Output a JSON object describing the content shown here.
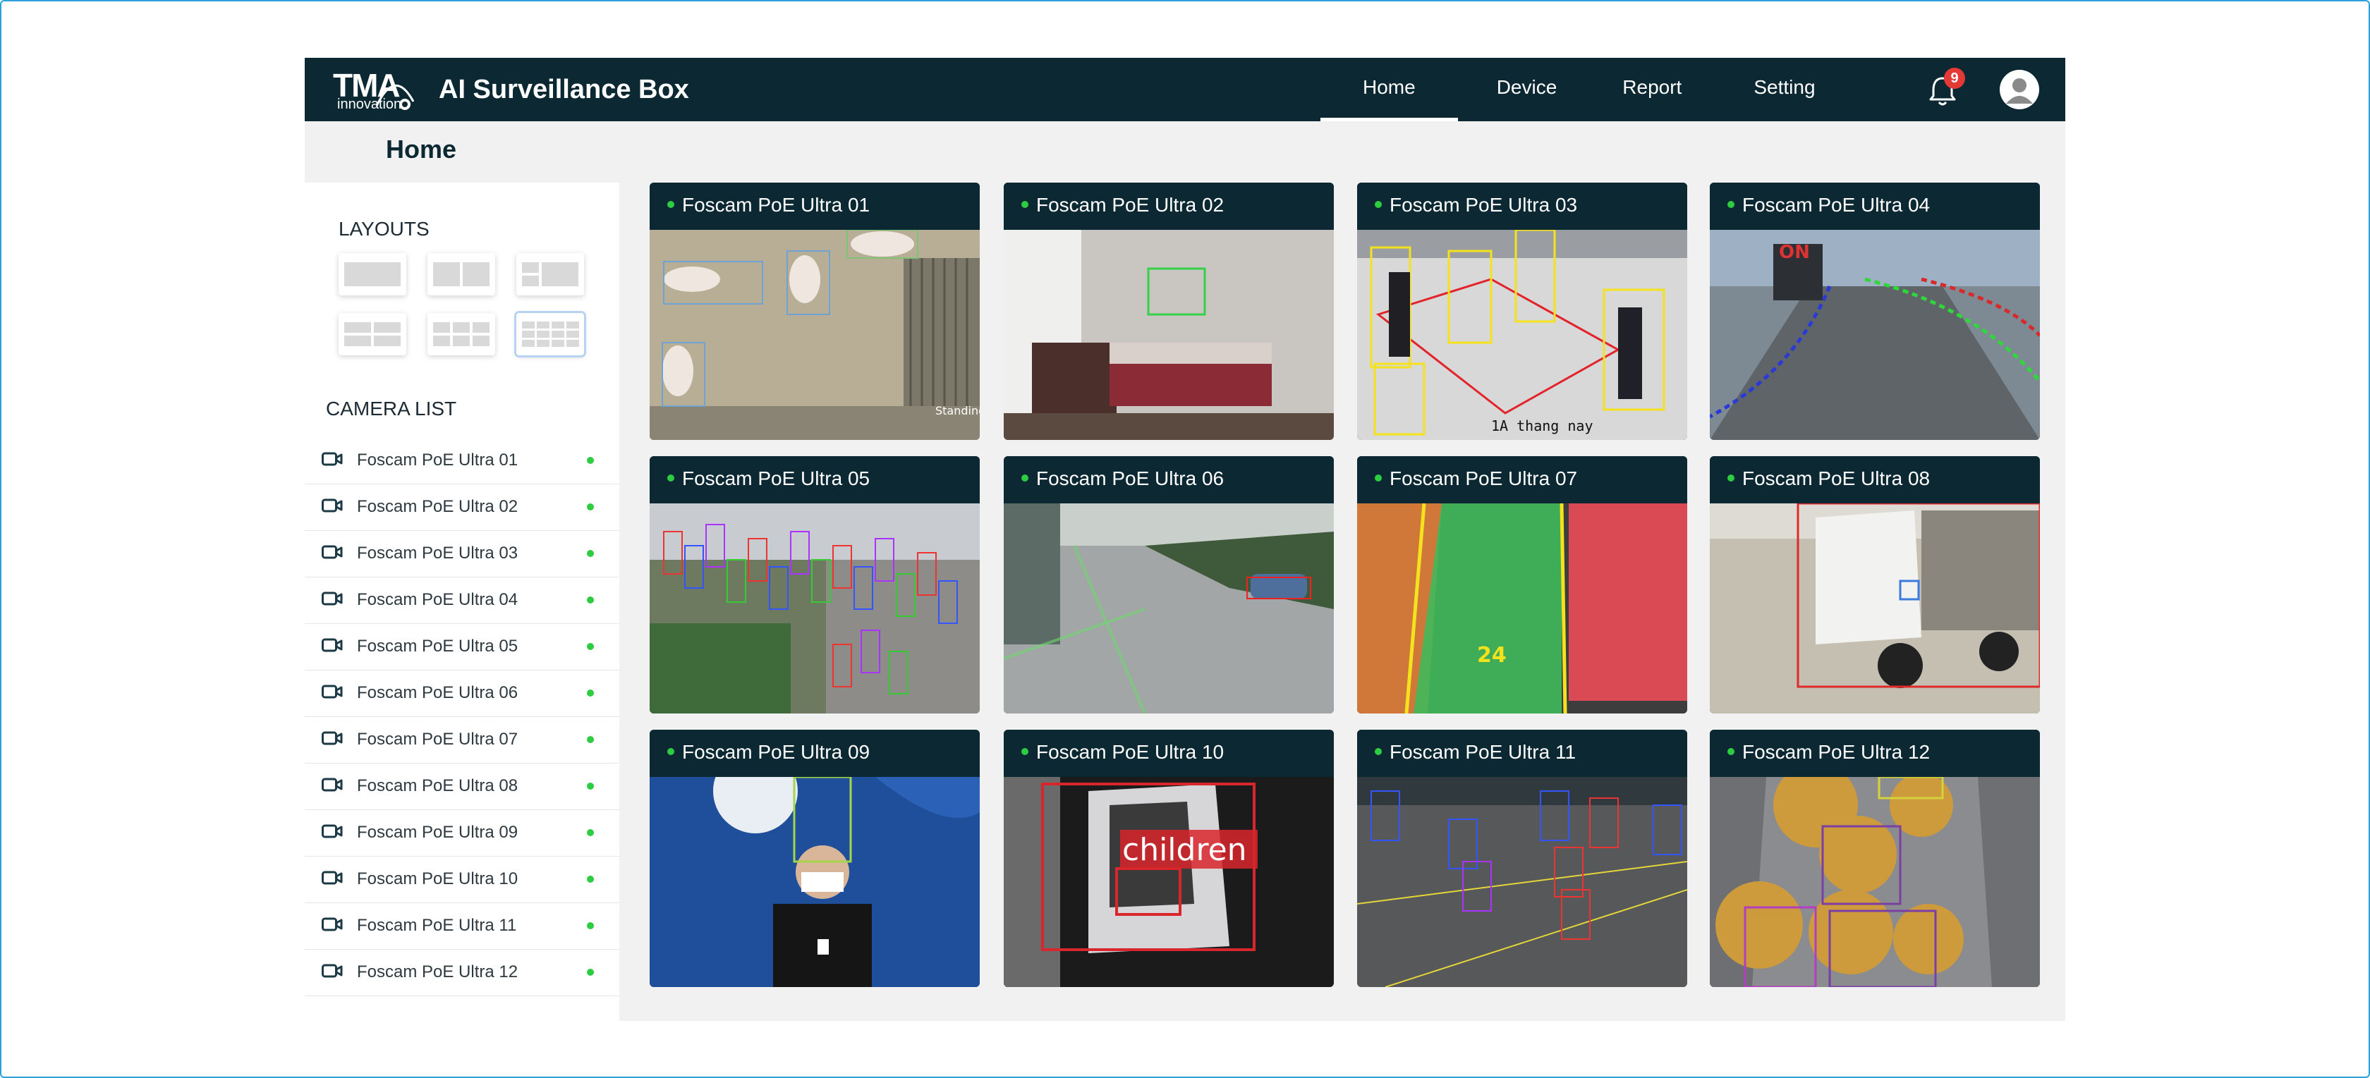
{
  "app": {
    "logo_text": "TMA",
    "logo_subtext": "innovation",
    "title": "AI Surveillance Box",
    "notification_count": "9"
  },
  "nav": {
    "items": [
      {
        "label": "Home",
        "active": true
      },
      {
        "label": "Device",
        "active": false
      },
      {
        "label": "Report",
        "active": false
      },
      {
        "label": "Setting",
        "active": false
      }
    ]
  },
  "page": {
    "title": "Home"
  },
  "sidebar": {
    "layouts_title": "LAYOUTS",
    "layout_options": [
      {
        "name": "1x1",
        "selected": false
      },
      {
        "name": "2x1",
        "selected": false
      },
      {
        "name": "1+2",
        "selected": false
      },
      {
        "name": "2x2",
        "selected": false
      },
      {
        "name": "3x2",
        "selected": false
      },
      {
        "name": "4x3",
        "selected": true
      }
    ],
    "camera_list_title": "CAMERA LIST",
    "cameras": [
      {
        "name": "Foscam PoE Ultra 01",
        "status": "online"
      },
      {
        "name": "Foscam PoE Ultra 02",
        "status": "online"
      },
      {
        "name": "Foscam PoE Ultra 03",
        "status": "online"
      },
      {
        "name": "Foscam PoE Ultra 04",
        "status": "online"
      },
      {
        "name": "Foscam PoE Ultra 05",
        "status": "online"
      },
      {
        "name": "Foscam PoE Ultra 06",
        "status": "online"
      },
      {
        "name": "Foscam PoE Ultra 07",
        "status": "online"
      },
      {
        "name": "Foscam PoE Ultra 08",
        "status": "online"
      },
      {
        "name": "Foscam PoE Ultra 09",
        "status": "online"
      },
      {
        "name": "Foscam PoE Ultra 10",
        "status": "online"
      },
      {
        "name": "Foscam PoE Ultra 11",
        "status": "online"
      },
      {
        "name": "Foscam PoE Ultra 12",
        "status": "online"
      }
    ]
  },
  "grid": {
    "tiles": [
      {
        "name": "Foscam PoE Ultra 01",
        "overlay": "Standing"
      },
      {
        "name": "Foscam PoE Ultra 02",
        "overlay": ""
      },
      {
        "name": "Foscam PoE Ultra 03",
        "overlay": "1A thang nay"
      },
      {
        "name": "Foscam PoE Ultra 04",
        "overlay": "ON"
      },
      {
        "name": "Foscam PoE Ultra 05",
        "overlay": ""
      },
      {
        "name": "Foscam PoE Ultra 06",
        "overlay": ""
      },
      {
        "name": "Foscam PoE Ultra 07",
        "overlay": "24"
      },
      {
        "name": "Foscam PoE Ultra 08",
        "overlay": ""
      },
      {
        "name": "Foscam PoE Ultra 09",
        "overlay": ""
      },
      {
        "name": "Foscam PoE Ultra 10",
        "overlay": "children"
      },
      {
        "name": "Foscam PoE Ultra 11",
        "overlay": ""
      },
      {
        "name": "Foscam PoE Ultra 12",
        "overlay": ""
      }
    ]
  },
  "colors": {
    "header_bg": "#0b2833",
    "status_online": "#2ecc40",
    "badge": "#e53935",
    "selected_layout": "#b8d3f0"
  },
  "icons": [
    "bell-icon",
    "avatar-icon",
    "camera-icon",
    "status-dot"
  ]
}
